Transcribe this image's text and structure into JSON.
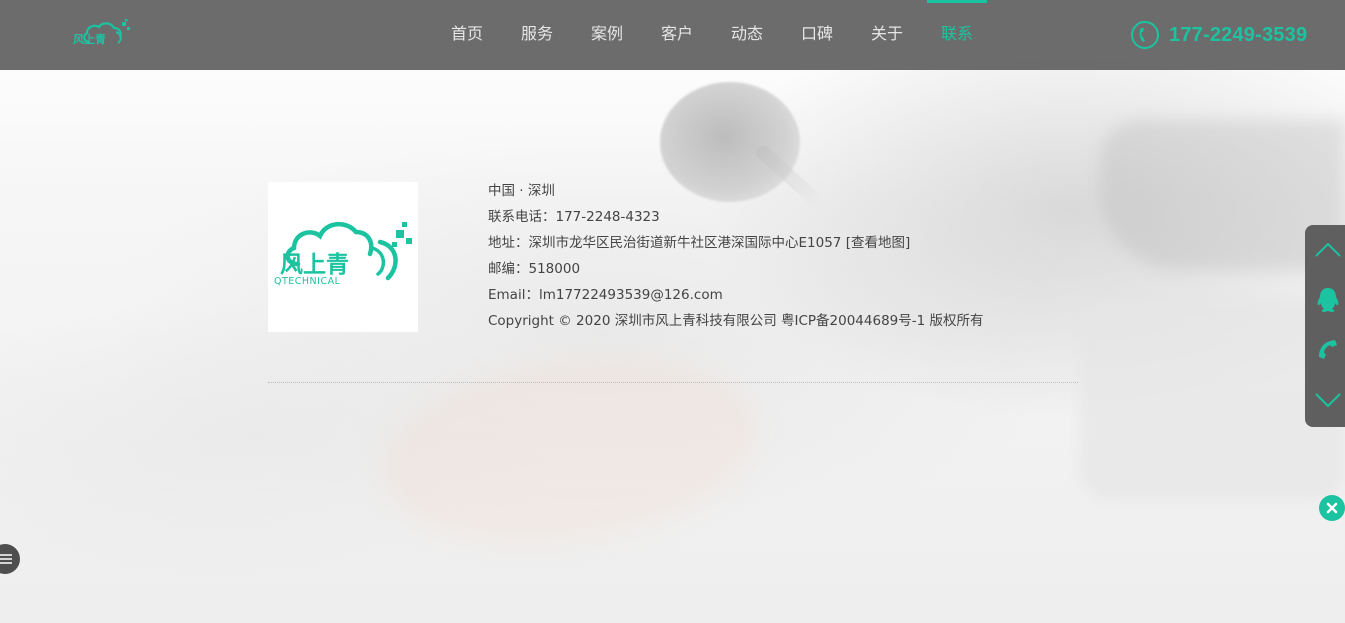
{
  "header": {
    "logo_text": "风上青",
    "nav": [
      "首页",
      "服务",
      "案例",
      "客户",
      "动态",
      "口碑",
      "关于",
      "联系"
    ],
    "active_index": 7,
    "hotline": "177-2249-3539"
  },
  "contact": {
    "logo_cn": "风上青",
    "logo_en": "QTECHNICAL",
    "city": "中国 · 深圳",
    "phone": "联系电话：177-2248-4323",
    "address": "地址：深圳市龙华区民治街道新牛社区港深国际中心E1057",
    "map_link": "[查看地图]",
    "postcode": "邮编：518000",
    "email": "Email：lm17722493539@126.com",
    "copyright": "Copyright © 2020  深圳市风上青科技有限公司 粤ICP备20044689号-1 版权所有"
  },
  "colors": {
    "accent": "#1bc3a0",
    "header_bg": "#5f5f5f",
    "text": "#444444"
  },
  "float_bar": {
    "icons": [
      "chevron-up-icon",
      "qq-icon",
      "phone-icon",
      "chevron-down-icon"
    ]
  }
}
